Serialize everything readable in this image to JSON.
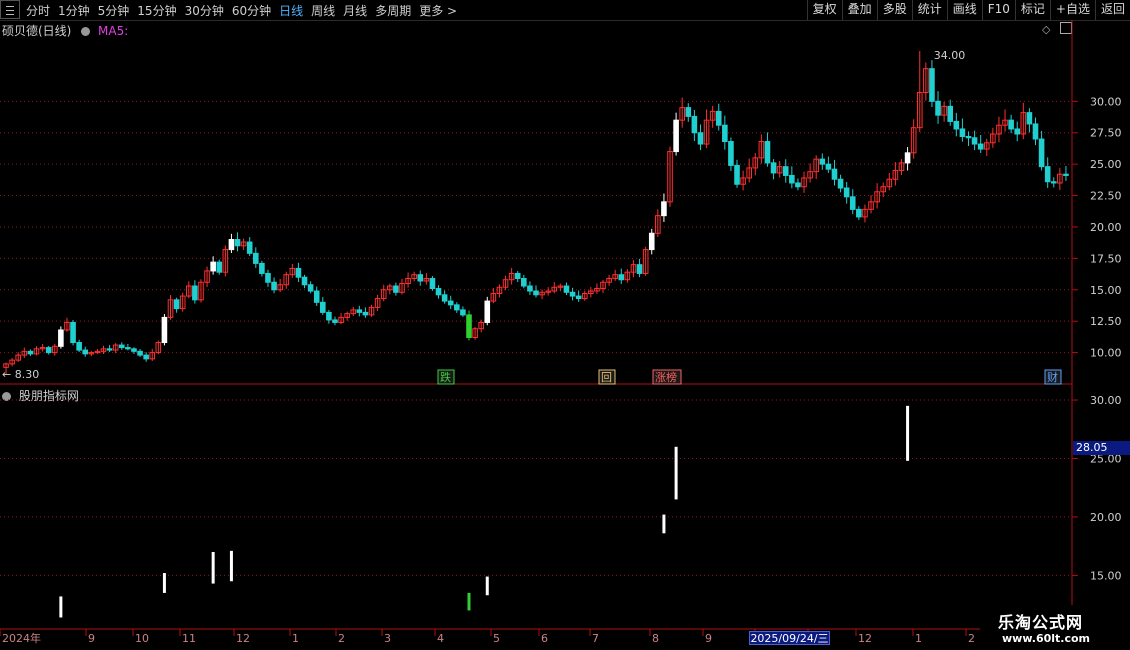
{
  "toolbar": {
    "periods": [
      "分时",
      "1分钟",
      "5分钟",
      "15分钟",
      "30分钟",
      "60分钟",
      "日线",
      "周线",
      "月线",
      "多周期",
      "更多 >"
    ],
    "active_period": "日线",
    "tools": [
      "复权",
      "叠加",
      "多股",
      "统计",
      "画线",
      "F10",
      "标记",
      "+自选",
      "返回"
    ]
  },
  "main_panel": {
    "title": "硕贝德(日线)",
    "indicator": "MA5:",
    "high_label": "34.00",
    "low_label": "8.30",
    "event_markers": [
      {
        "text": "跌",
        "color": "#3ccf3c"
      },
      {
        "text": "回",
        "color": "#e8c070"
      },
      {
        "text": "涨榜",
        "color": "#ff6060"
      },
      {
        "text": "财",
        "color": "#60a0ff"
      }
    ]
  },
  "sub_panel": {
    "title": "股朋指标网",
    "cursor_value": "28.05"
  },
  "x_axis": {
    "labels": [
      "2024年",
      "9",
      "10",
      "11",
      "12",
      "1",
      "2",
      "3",
      "4",
      "5",
      "6",
      "7",
      "8",
      "9",
      "10",
      "11",
      "12",
      "1",
      "2"
    ],
    "cursor_date": "2025/09/24/三"
  },
  "watermark": {
    "title": "乐淘公式网",
    "url": "www.60lt.com"
  },
  "colors": {
    "up": "#ff3030",
    "down": "#20d0d0",
    "grid": "#8a1a1a",
    "highlight": "#ffffff",
    "green": "#30d030"
  },
  "chart_data": [
    {
      "type": "candlestick",
      "name": "main",
      "y_ticks": [
        10.0,
        12.5,
        15.0,
        17.5,
        20.0,
        22.5,
        25.0,
        27.5,
        30.0
      ],
      "ylim": [
        7.5,
        35.2
      ],
      "close": [
        9.1,
        9.4,
        9.8,
        10.1,
        9.9,
        10.3,
        10.4,
        10.0,
        10.5,
        11.8,
        12.4,
        10.8,
        10.2,
        9.9,
        10.0,
        10.1,
        10.3,
        10.2,
        10.6,
        10.4,
        10.3,
        10.1,
        9.8,
        9.5,
        10.0,
        10.8,
        12.8,
        14.2,
        13.5,
        14.5,
        15.3,
        14.2,
        15.6,
        16.5,
        17.2,
        16.4,
        18.2,
        19.0,
        18.5,
        18.8,
        17.9,
        17.1,
        16.3,
        15.6,
        15.0,
        15.4,
        16.2,
        16.7,
        16.0,
        15.4,
        14.9,
        14.0,
        13.2,
        12.6,
        12.4,
        12.8,
        13.1,
        13.4,
        13.2,
        13.0,
        13.6,
        14.3,
        15.0,
        15.3,
        14.8,
        15.5,
        15.9,
        16.2,
        15.7,
        15.9,
        15.1,
        14.6,
        14.1,
        13.8,
        13.4,
        13.0,
        11.2,
        11.9,
        12.4,
        14.1,
        14.7,
        15.2,
        15.8,
        16.3,
        15.9,
        15.3,
        14.9,
        14.6,
        14.8,
        14.9,
        15.2,
        15.3,
        14.8,
        14.5,
        14.3,
        14.7,
        14.9,
        15.1,
        15.6,
        15.9,
        16.2,
        15.8,
        16.4,
        17.0,
        16.3,
        18.2,
        19.5,
        20.9,
        22.0,
        26.0,
        28.5,
        29.5,
        28.8,
        27.5,
        26.6,
        28.5,
        29.2,
        28.1,
        26.8,
        24.9,
        23.4,
        23.9,
        24.7,
        25.5,
        26.8,
        25.1,
        24.3,
        24.8,
        24.1,
        23.5,
        23.2,
        23.9,
        24.4,
        25.4,
        25.0,
        24.6,
        23.8,
        23.1,
        22.4,
        21.4,
        20.8,
        21.4,
        22.0,
        22.8,
        23.2,
        23.8,
        24.5,
        25.1,
        25.9,
        27.9,
        30.7,
        32.6,
        30.0,
        28.9,
        29.6,
        28.4,
        27.8,
        27.2,
        27.1,
        26.6,
        26.2,
        26.7,
        27.4,
        28.1,
        28.5,
        27.8,
        27.4,
        29.1,
        28.2,
        27.0,
        24.8,
        23.6,
        23.5,
        24.2,
        24.1
      ],
      "highlight_days": [
        9,
        26,
        34,
        37,
        76,
        79,
        106,
        108,
        110,
        148
      ],
      "green_days": [
        76
      ],
      "high_point": {
        "day": 150,
        "value": 34.0
      },
      "low_point": {
        "day": 0,
        "value": 8.3
      }
    },
    {
      "type": "bar-markers",
      "name": "sub",
      "y_ticks": [
        15.0,
        20.0,
        25.0,
        30.0
      ],
      "ylim": [
        10.5,
        31.2
      ],
      "bars": [
        {
          "day": 9,
          "low": 11.4,
          "high": 13.2,
          "color": "white"
        },
        {
          "day": 26,
          "low": 13.5,
          "high": 15.2,
          "color": "white"
        },
        {
          "day": 34,
          "low": 14.3,
          "high": 17.0,
          "color": "white"
        },
        {
          "day": 37,
          "low": 14.5,
          "high": 17.1,
          "color": "white"
        },
        {
          "day": 76,
          "low": 12.0,
          "high": 13.5,
          "color": "green"
        },
        {
          "day": 79,
          "low": 13.3,
          "high": 14.9,
          "color": "white"
        },
        {
          "day": 108,
          "low": 18.6,
          "high": 20.2,
          "color": "white"
        },
        {
          "day": 110,
          "low": 21.5,
          "high": 26.0,
          "color": "white"
        },
        {
          "day": 148,
          "low": 24.8,
          "high": 29.5,
          "color": "white"
        }
      ]
    }
  ]
}
